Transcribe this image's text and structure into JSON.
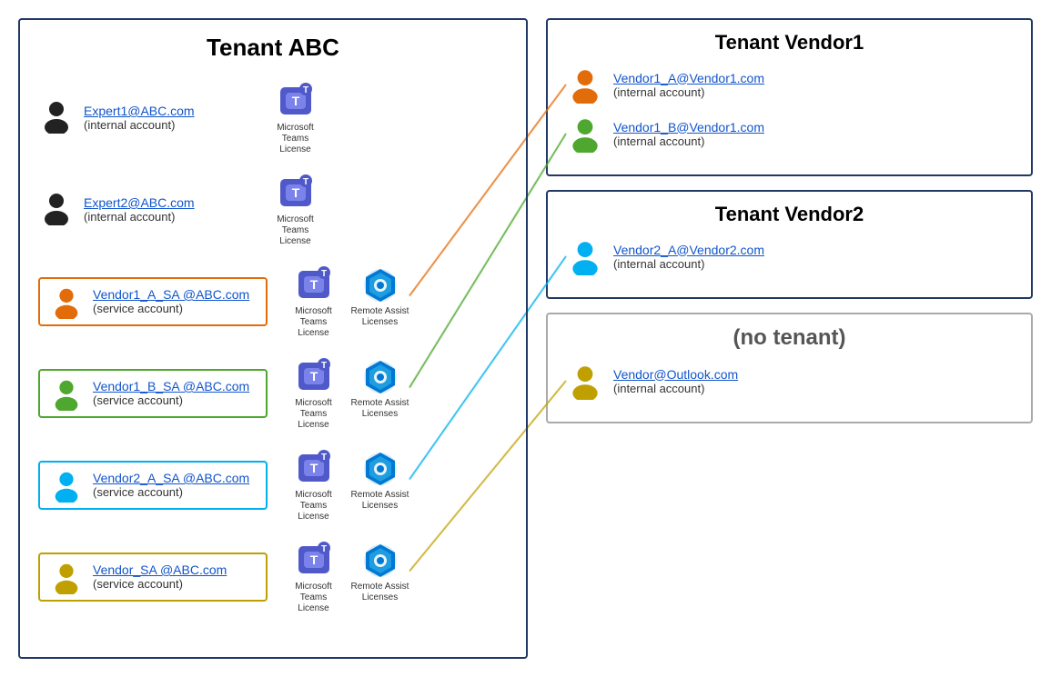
{
  "tenantABC": {
    "title": "Tenant ABC",
    "users": [
      {
        "id": "expert1",
        "email": "Expert1@ABC.com",
        "type": "(internal account)",
        "color": "#222222",
        "licenses": [
          "teams"
        ],
        "isServiceAccount": false
      },
      {
        "id": "expert2",
        "email": "Expert2@ABC.com",
        "type": "(internal account)",
        "color": "#222222",
        "licenses": [
          "teams"
        ],
        "isServiceAccount": false
      },
      {
        "id": "vendor1a_sa",
        "email": "Vendor1_A_SA @ABC.com",
        "type": "(service account)",
        "color": "#e36c0a",
        "licenses": [
          "teams",
          "remote"
        ],
        "isServiceAccount": true,
        "boxClass": "orange"
      },
      {
        "id": "vendor1b_sa",
        "email": "Vendor1_B_SA @ABC.com",
        "type": "(service account)",
        "color": "#4ea72e",
        "licenses": [
          "teams",
          "remote"
        ],
        "isServiceAccount": true,
        "boxClass": "green"
      },
      {
        "id": "vendor2a_sa",
        "email": "Vendor2_A_SA @ABC.com",
        "type": "(service account)",
        "color": "#00b0f0",
        "licenses": [
          "teams",
          "remote"
        ],
        "isServiceAccount": true,
        "boxClass": "teal"
      },
      {
        "id": "vendor_sa",
        "email": "Vendor_SA @ABC.com",
        "type": "(service account)",
        "color": "#c0a000",
        "licenses": [
          "teams",
          "remote"
        ],
        "isServiceAccount": true,
        "boxClass": "gold"
      }
    ]
  },
  "tenantVendor1": {
    "title": "Tenant Vendor1",
    "users": [
      {
        "id": "vendor1a",
        "email": "Vendor1_A@Vendor1.com",
        "type": "(internal account)",
        "color": "#e36c0a"
      },
      {
        "id": "vendor1b",
        "email": "Vendor1_B@Vendor1.com",
        "type": "(internal account)",
        "color": "#4ea72e"
      }
    ]
  },
  "tenantVendor2": {
    "title": "Tenant Vendor2",
    "users": [
      {
        "id": "vendor2a",
        "email": "Vendor2_A@Vendor2.com",
        "type": "(internal account)",
        "color": "#00b0f0"
      }
    ]
  },
  "noTenant": {
    "title": "(no tenant)",
    "users": [
      {
        "id": "vendor_outlook",
        "email": "Vendor@Outlook.com",
        "type": "(internal account)",
        "color": "#c0a000"
      }
    ]
  },
  "licenses": {
    "teams_label": "Microsoft Teams License",
    "remote_label": "Remote Assist Licenses"
  }
}
